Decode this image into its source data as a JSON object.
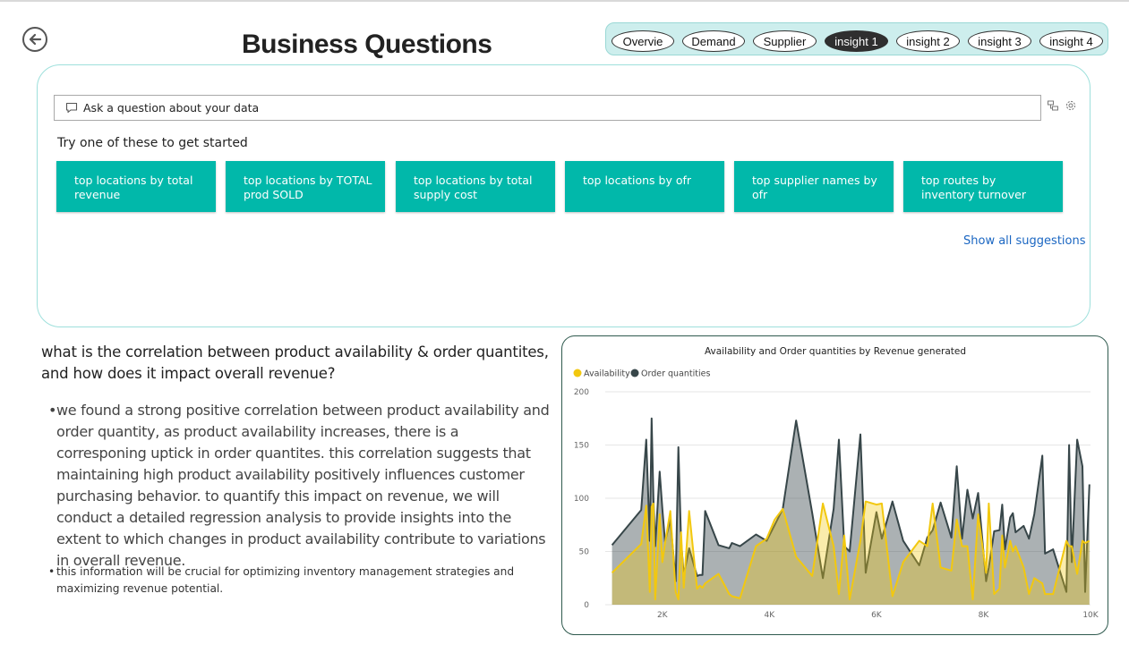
{
  "page": {
    "title": "Business Questions"
  },
  "nav": {
    "items": [
      {
        "label": "Overvie",
        "active": false
      },
      {
        "label": "Demand",
        "active": false
      },
      {
        "label": "Supplier",
        "active": false
      },
      {
        "label": "insight 1",
        "active": true
      },
      {
        "label": "insight 2",
        "active": false
      },
      {
        "label": "insight 3",
        "active": false
      },
      {
        "label": "insight 4",
        "active": false
      }
    ]
  },
  "qa": {
    "placeholder": "Ask a question about your data",
    "try_label": "Try one of these to get started",
    "suggestions": [
      "top locations by total revenue",
      "top locations by TOTAL prod SOLD",
      "top locations by total supply cost",
      "top locations by ofr",
      "top supplier names by ofr",
      "top routes by inventory turnover"
    ],
    "show_all": "Show all suggestions"
  },
  "insight": {
    "question": "what is the correlation between product availability & order quantites, and how does it impact overall revenue?",
    "bullets": [
      "we found a strong positive correlation between product availability and order quantity, as product availability increases, there is a corresponing uptick in order quantites. this correlation suggests that maintaining  high product availability positively influences customer purchasing behavior. to quantify this impact on revenue, we will conduct a detailed regression analysis to provide insights into the extent to which changes in product availability contribute to variations in overall revenue.",
      "this information will be crucial for optimizing inventory management strategies and maximizing revenue potential."
    ]
  },
  "colors": {
    "accent": "#01b8aa",
    "availability": "#f2c80f",
    "order_quantities": "#374649",
    "nav_active": "#2f2f2f"
  },
  "chart_data": {
    "type": "area",
    "title": "Availability and Order quantities by Revenue generated",
    "legend_position": "top-left",
    "grid": true,
    "x_ticks": [
      2000,
      4000,
      6000,
      8000,
      10000
    ],
    "x_tick_labels": [
      "2K",
      "4K",
      "6K",
      "8K",
      "10K"
    ],
    "y_ticks": [
      0,
      50,
      100,
      150,
      200
    ],
    "xlim": [
      1000,
      10000
    ],
    "ylim": [
      0,
      200
    ],
    "x": [
      1061,
      1605,
      1700,
      1767,
      1800,
      1833,
      1867,
      1950,
      2000,
      2050,
      2150,
      2250,
      2300,
      2350,
      2400,
      2500,
      2650,
      2700,
      2750,
      2800,
      3050,
      3250,
      3300,
      3450,
      3750,
      3950,
      4100,
      4250,
      4500,
      4800,
      5000,
      5200,
      5300,
      5400,
      5500,
      5700,
      5800,
      6000,
      6100,
      6300,
      6500,
      6800,
      6950,
      7050,
      7200,
      7400,
      7500,
      7600,
      7700,
      7800,
      7900,
      8050,
      8100,
      8200,
      8300,
      8350,
      8400,
      8500,
      8550,
      8600,
      8750,
      8850,
      8950,
      9100,
      9150,
      9300,
      9550,
      9600,
      9650,
      9750,
      9850,
      9900,
      9980
    ],
    "series": [
      {
        "name": "Availability",
        "values": [
          30,
          57,
          93,
          12,
          92,
          95,
          5,
          85,
          40,
          58,
          88,
          12,
          5,
          68,
          16,
          88,
          15,
          18,
          16,
          20,
          29,
          10,
          8,
          6,
          55,
          62,
          80,
          90,
          45,
          27,
          95,
          55,
          10,
          65,
          5,
          60,
          97,
          94,
          95,
          8,
          40,
          60,
          55,
          95,
          35,
          32,
          80,
          55,
          55,
          5,
          85,
          30,
          95,
          10,
          15,
          65,
          35,
          60,
          50,
          55,
          35,
          10,
          25,
          20,
          10,
          10,
          60,
          55,
          55,
          29,
          60,
          58,
          60
        ]
      },
      {
        "name": "Order quantities",
        "values": [
          56,
          89,
          155,
          60,
          175,
          100,
          55,
          125,
          90,
          59,
          80,
          22,
          148,
          60,
          28,
          53,
          27,
          28,
          28,
          88,
          56,
          53,
          58,
          55,
          66,
          60,
          75,
          90,
          173,
          86,
          25,
          90,
          155,
          55,
          50,
          160,
          30,
          87,
          62,
          97,
          60,
          37,
          63,
          70,
          96,
          63,
          130,
          62,
          108,
          81,
          105,
          22,
          35,
          69,
          70,
          94,
          52,
          82,
          86,
          68,
          74,
          62,
          85,
          140,
          48,
          52,
          12,
          150,
          40,
          155,
          130,
          12,
          113
        ]
      }
    ]
  }
}
